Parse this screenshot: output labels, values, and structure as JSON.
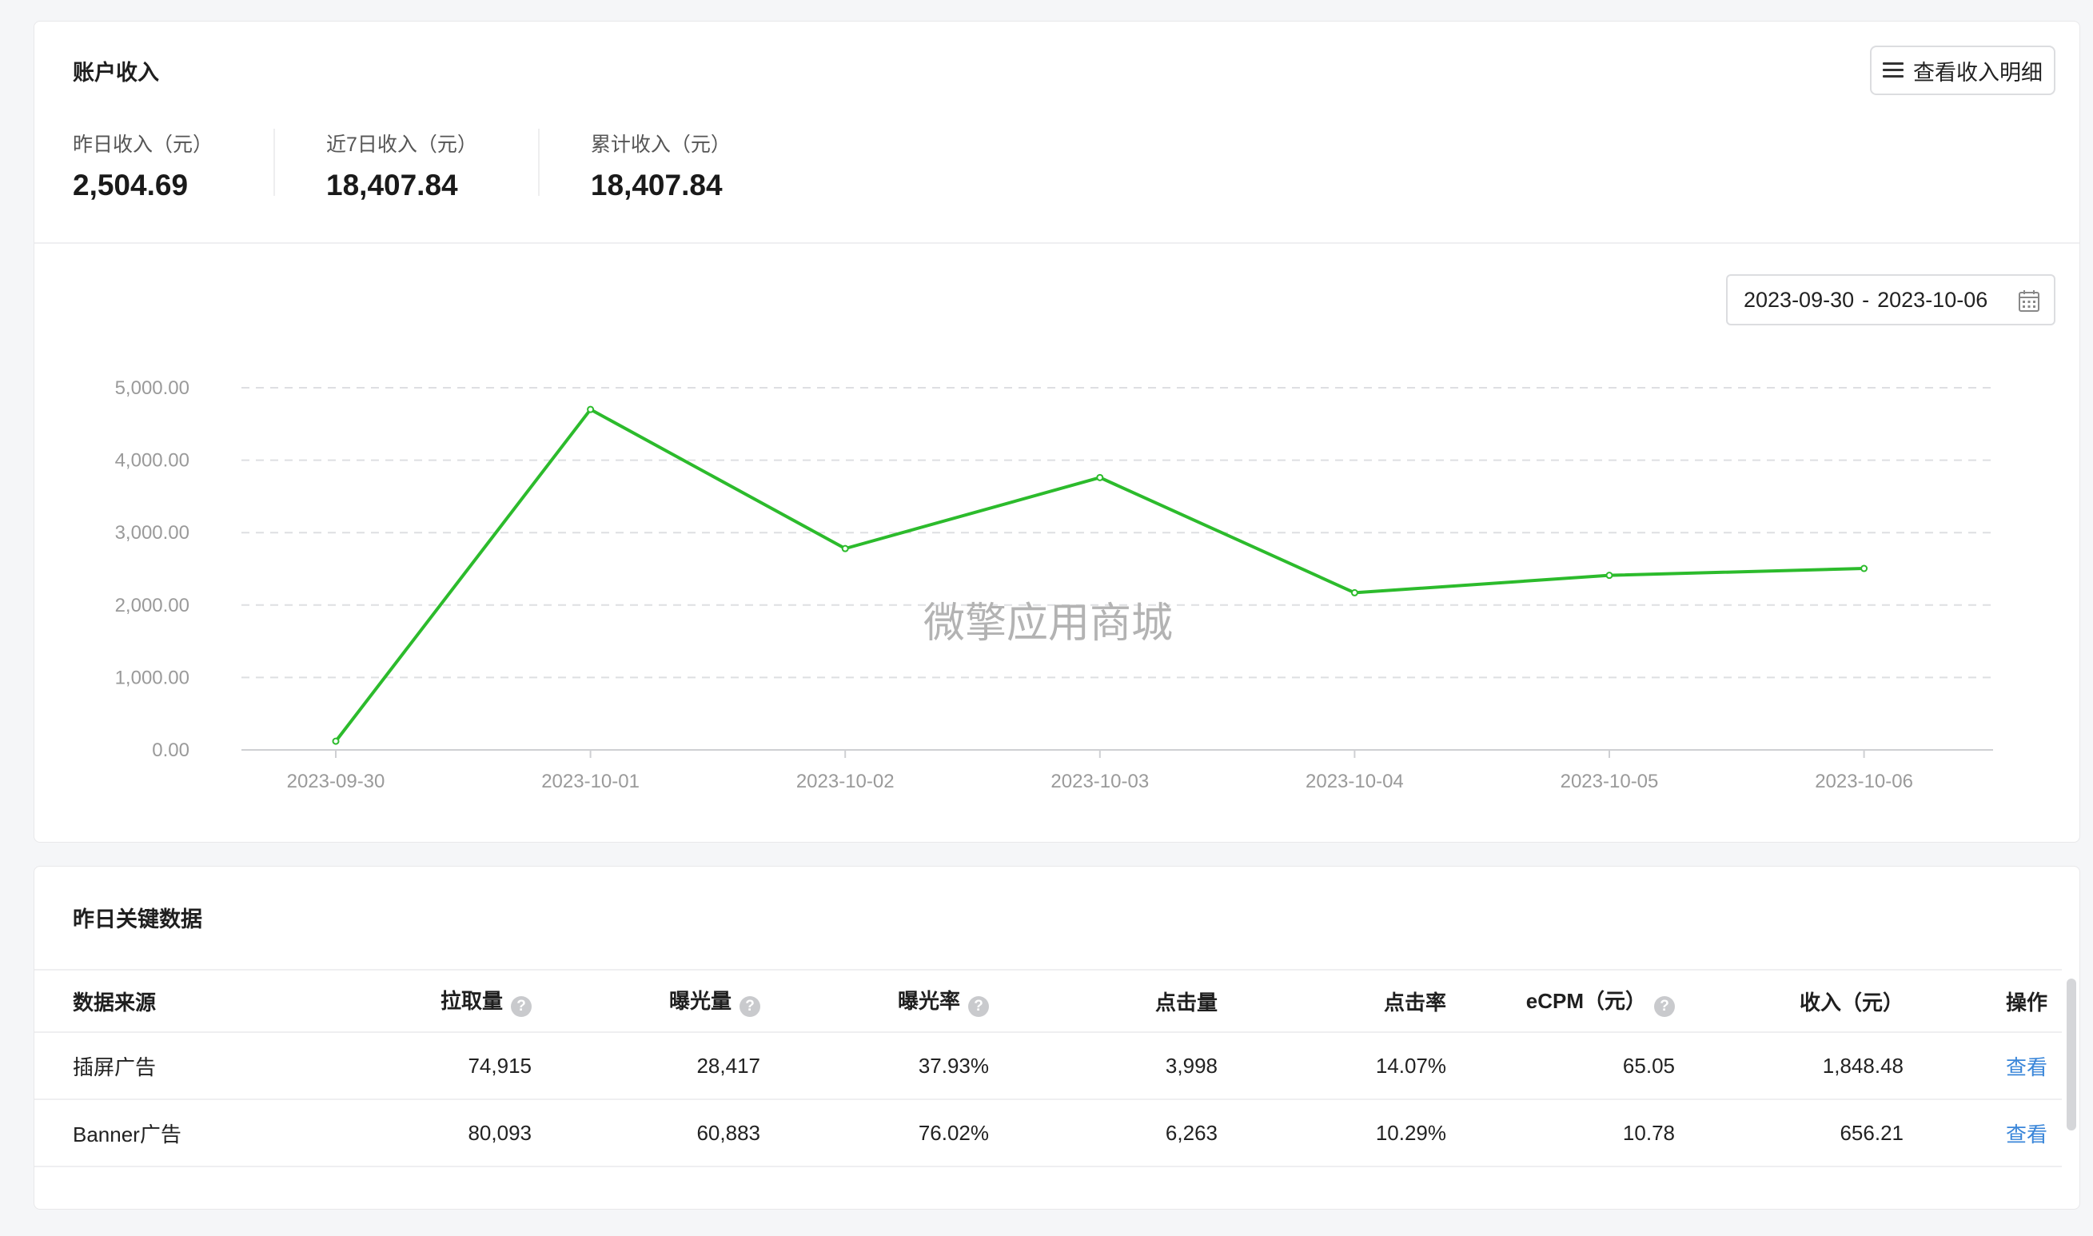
{
  "income_card": {
    "title": "账户收入",
    "detail_button": "查看收入明细",
    "stats": [
      {
        "label": "昨日收入（元）",
        "value": "2,504.69"
      },
      {
        "label": "近7日收入（元）",
        "value": "18,407.84"
      },
      {
        "label": "累计收入（元）",
        "value": "18,407.84"
      }
    ],
    "date_range": {
      "start": "2023-09-30",
      "separator": "-",
      "end": "2023-10-06"
    },
    "watermark": "微擎应用商城"
  },
  "chart_data": {
    "type": "line",
    "x": [
      "2023-09-30",
      "2023-10-01",
      "2023-10-02",
      "2023-10-03",
      "2023-10-04",
      "2023-10-05",
      "2023-10-06"
    ],
    "series": [
      {
        "values": [
          120,
          4700,
          2780,
          3760,
          2170,
          2410,
          2505
        ],
        "color": "#2cbb2c"
      }
    ],
    "y_ticks": [
      "0.00",
      "1,000.00",
      "2,000.00",
      "3,000.00",
      "4,000.00",
      "5,000.00"
    ],
    "ylim": [
      0,
      5000
    ],
    "grid": true,
    "legend": "none"
  },
  "key_card": {
    "title": "昨日关键数据",
    "columns": [
      {
        "label": "数据来源",
        "help": false
      },
      {
        "label": "拉取量",
        "help": true
      },
      {
        "label": "曝光量",
        "help": true
      },
      {
        "label": "曝光率",
        "help": true
      },
      {
        "label": "点击量",
        "help": false
      },
      {
        "label": "点击率",
        "help": false
      },
      {
        "label": "eCPM（元）",
        "help": true
      },
      {
        "label": "收入（元）",
        "help": false
      },
      {
        "label": "操作",
        "help": false
      }
    ],
    "rows": [
      {
        "source": "插屏广告",
        "pulls": "74,915",
        "impressions": "28,417",
        "impression_rate": "37.93%",
        "clicks": "3,998",
        "ctr": "14.07%",
        "ecpm": "65.05",
        "income": "1,848.48",
        "action": "查看"
      },
      {
        "source": "Banner广告",
        "pulls": "80,093",
        "impressions": "60,883",
        "impression_rate": "76.02%",
        "clicks": "6,263",
        "ctr": "10.29%",
        "ecpm": "10.78",
        "income": "656.21",
        "action": "查看"
      }
    ],
    "help_glyph": "?"
  }
}
